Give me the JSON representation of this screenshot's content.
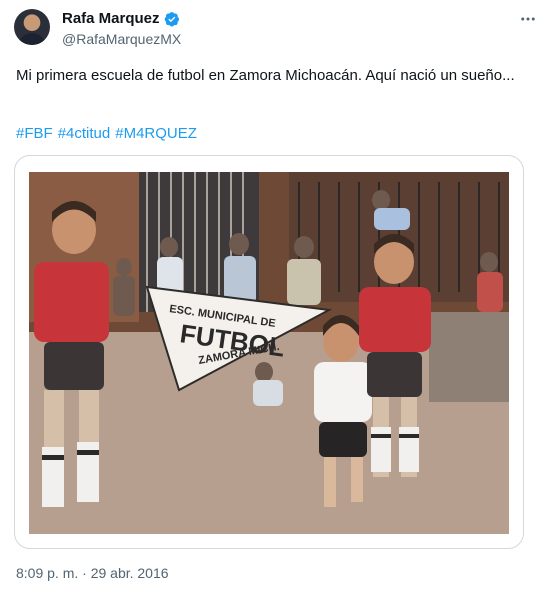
{
  "author": {
    "name": "Rafa Marquez",
    "handle": "@RafaMarquezMX",
    "verified": true
  },
  "tweet": {
    "text": "Mi primera escuela de futbol en Zamora Michoacán. Aquí nació un sueño...",
    "hashtags": [
      "#FBF",
      "#4ctitud",
      "#M4RQUEZ"
    ],
    "timestamp": "8:09 p. m. · 29 abr. 2016"
  },
  "photo": {
    "banner_line1": "ESC. MUNICIPAL DE",
    "banner_line2": "FUTBOL",
    "banner_line3": "ZAMORA MICH."
  },
  "icons": {
    "more": "more-options-icon",
    "verified": "verified-badge-icon"
  },
  "colors": {
    "link": "#1d9bf0",
    "secondary_text": "#536471",
    "border": "#cfd9de"
  }
}
